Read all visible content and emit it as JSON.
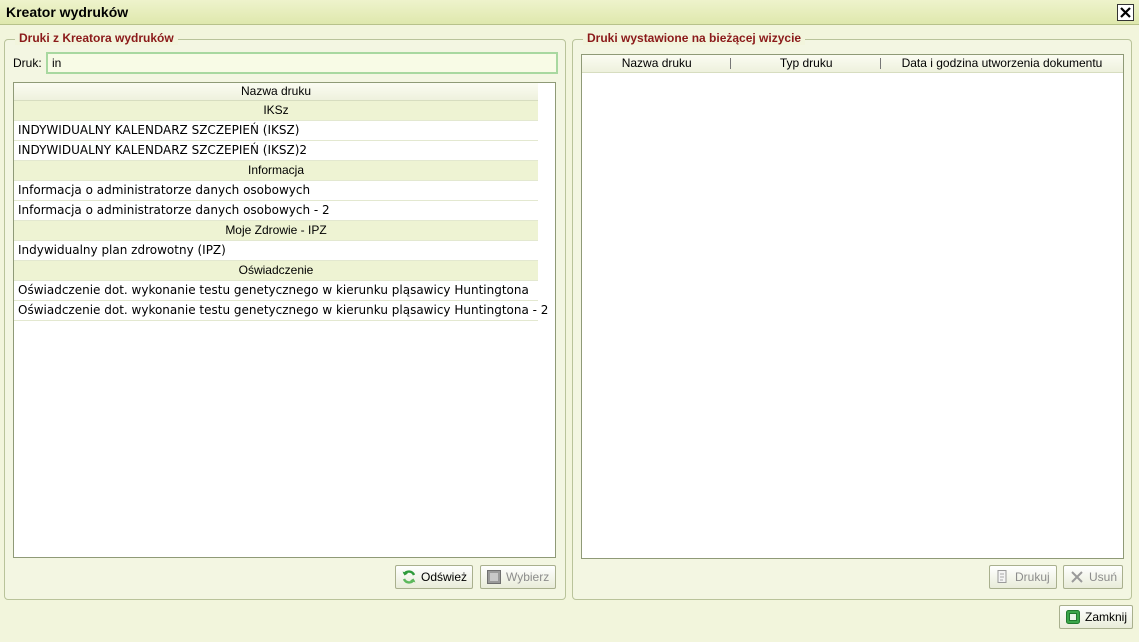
{
  "window": {
    "title": "Kreator wydruków",
    "close_label": "✕"
  },
  "left_panel": {
    "legend": "Druki z Kreatora wydruków",
    "druk_label": "Druk:",
    "druk_value": "in",
    "column_header": "Nazwa druku",
    "groups": [
      {
        "name": "IKSz",
        "items": [
          "INDYWIDUALNY KALENDARZ SZCZEPIEŃ (IKSZ)",
          "INDYWIDUALNY KALENDARZ SZCZEPIEŃ (IKSZ)2"
        ]
      },
      {
        "name": "Informacja",
        "items": [
          "Informacja o administratorze danych osobowych",
          "Informacja o administratorze danych osobowych - 2"
        ]
      },
      {
        "name": "Moje Zdrowie - IPZ",
        "items": [
          "Indywidualny plan zdrowotny (IPZ)"
        ]
      },
      {
        "name": "Oświadczenie",
        "items": [
          "Oświadczenie  dot. wykonanie testu genetycznego w kierunku pląsawicy Huntingtona",
          "Oświadczenie  dot. wykonanie testu genetycznego w kierunku pląsawicy Huntingtona - 2"
        ]
      }
    ],
    "buttons": {
      "refresh": "Odśwież",
      "select": "Wybierz"
    }
  },
  "right_panel": {
    "legend": "Druki wystawione na bieżącej wizycie",
    "columns": [
      "Nazwa druku",
      "Typ druku",
      "Data i godzina utworzenia dokumentu"
    ],
    "buttons": {
      "print": "Drukuj",
      "delete": "Usuń"
    }
  },
  "footer": {
    "close": "Zamknij"
  },
  "colors": {
    "legend_text": "#8b1a1a",
    "background": "#f2f5dc",
    "group_row": "#eef3d3",
    "input_border": "#a8d8a0"
  },
  "icons": {
    "refresh": "refresh-icon",
    "select": "checkbox-icon",
    "print": "printer-icon",
    "delete": "delete-x-icon",
    "close": "close-door-icon"
  }
}
